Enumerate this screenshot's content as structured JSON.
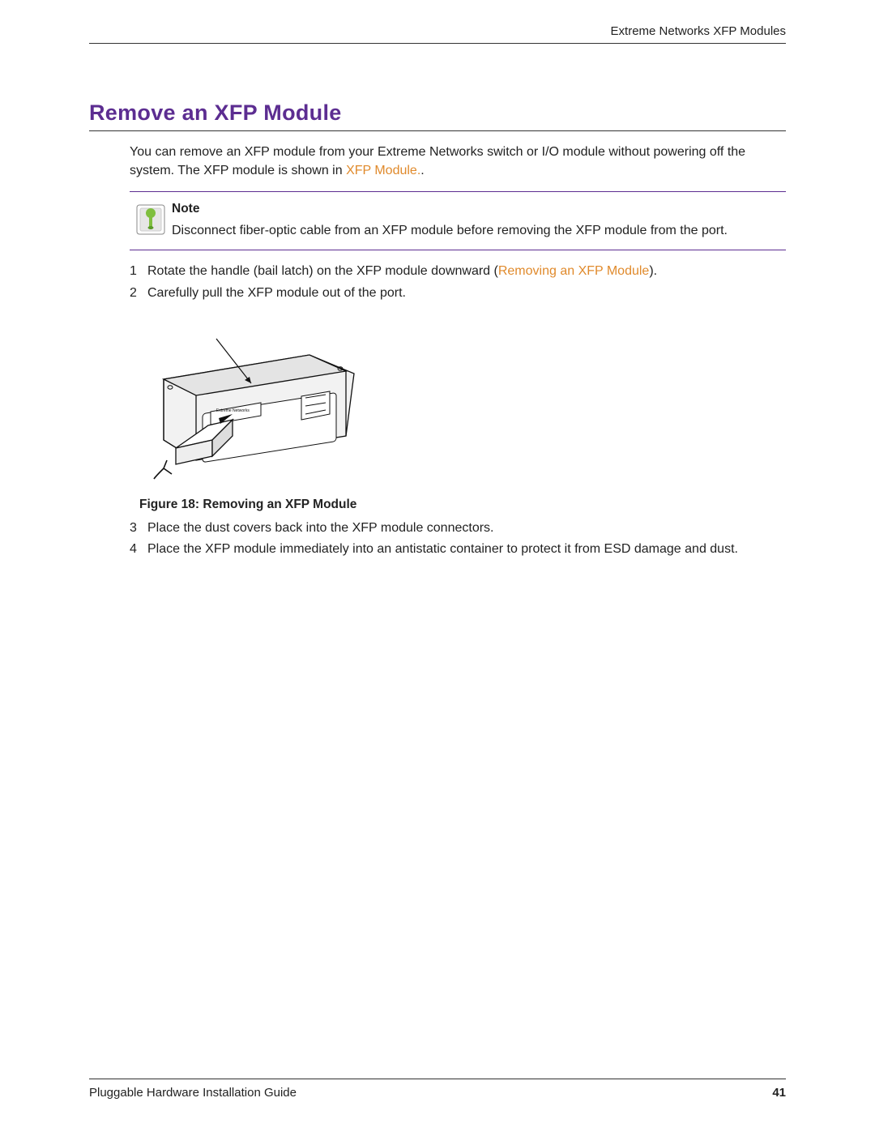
{
  "header": {
    "running": "Extreme Networks XFP Modules"
  },
  "section": {
    "title": "Remove an XFP Module",
    "intro_before_link": "You can remove an XFP module from your Extreme Networks switch or I/O module without powering off the system. The XFP module is shown in ",
    "intro_link": "XFP Module.",
    "intro_after_link": "."
  },
  "note": {
    "title": "Note",
    "body": "Disconnect fiber-optic cable from an XFP module before removing the XFP module from the port."
  },
  "steps_a": [
    {
      "before_link": "Rotate the handle (bail latch) on the XFP module downward (",
      "link": "Removing an XFP Module",
      "after_link": ")."
    },
    {
      "before_link": "Carefully pull the XFP module out of the port.",
      "link": "",
      "after_link": ""
    }
  ],
  "figure": {
    "caption": "Figure 18: Removing an XFP Module"
  },
  "steps_b": [
    "Place the dust covers back into the XFP module connectors.",
    "Place the XFP module immediately into an antistatic container to protect it from ESD damage and dust."
  ],
  "footer": {
    "doc_title": "Pluggable Hardware Installation Guide",
    "page_number": "41"
  }
}
